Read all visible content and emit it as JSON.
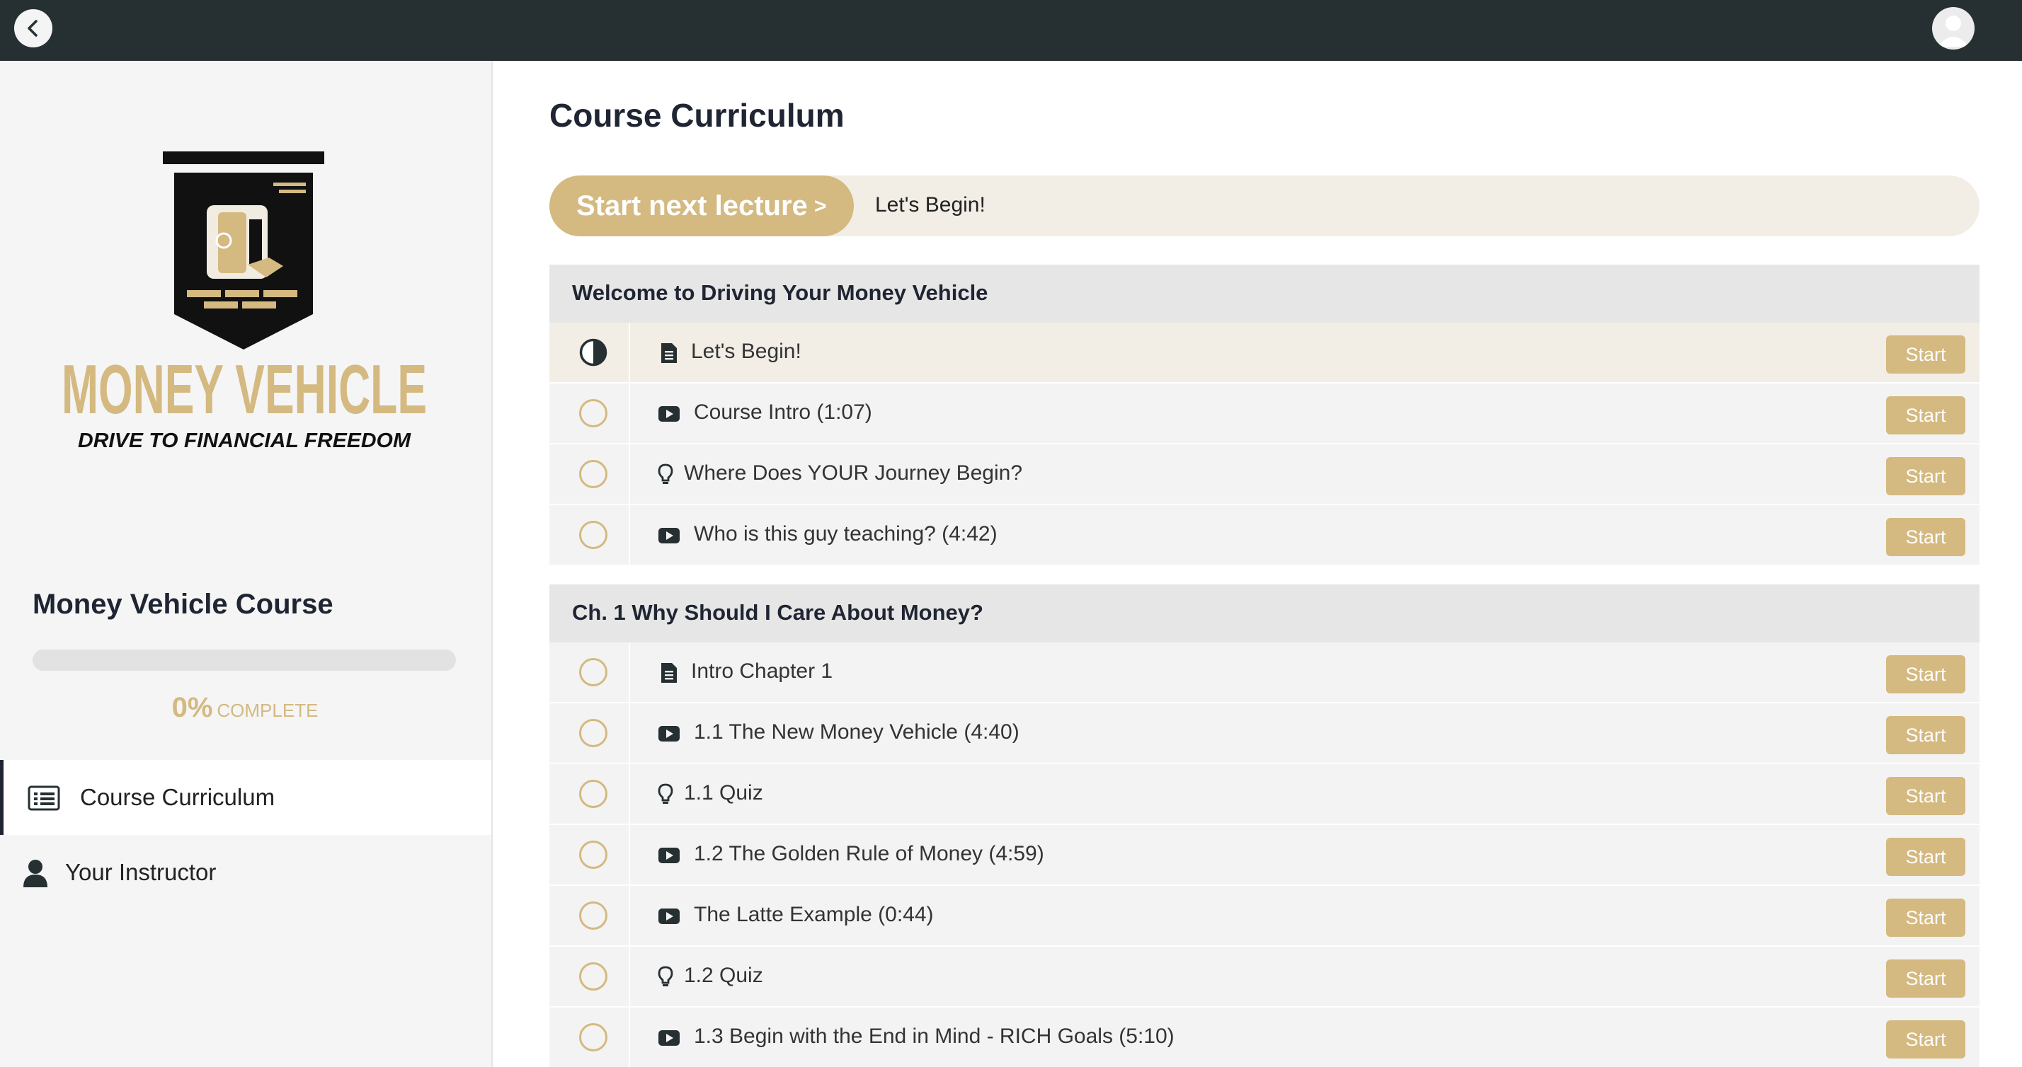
{
  "topbar": {
    "back_icon": "chevron-left-icon",
    "avatar_icon": "user-avatar-icon"
  },
  "sidebar": {
    "logo": {
      "brand": "MONEY VEHICLE",
      "tagline": "DRIVE TO FINANCIAL FREEDOM"
    },
    "course_title": "Money Vehicle Course",
    "progress": {
      "percent": 0,
      "percent_label": "0%",
      "complete_label": "COMPLETE"
    },
    "nav": [
      {
        "label": "Course Curriculum",
        "icon": "list-icon",
        "active": true
      },
      {
        "label": "Your Instructor",
        "icon": "user-icon",
        "active": false
      }
    ]
  },
  "main": {
    "title": "Course Curriculum",
    "next": {
      "button_label": "Start next lecture",
      "chevron": ">",
      "lecture": "Let's Begin!"
    },
    "sections": [
      {
        "title": "Welcome to Driving Your Money Vehicle",
        "lectures": [
          {
            "title": "Let's Begin!",
            "type": "document",
            "status": "in-progress",
            "action": "Start"
          },
          {
            "title": "Course Intro (1:07)",
            "type": "video",
            "status": "not-started",
            "action": "Start"
          },
          {
            "title": "Where Does YOUR Journey Begin?",
            "type": "quiz",
            "status": "not-started",
            "action": "Start"
          },
          {
            "title": "Who is this guy teaching? (4:42)",
            "type": "video",
            "status": "not-started",
            "action": "Start"
          }
        ]
      },
      {
        "title": "Ch. 1 Why Should I Care About Money?",
        "lectures": [
          {
            "title": "Intro Chapter 1",
            "type": "document",
            "status": "not-started",
            "action": "Start"
          },
          {
            "title": "1.1 The New Money Vehicle (4:40)",
            "type": "video",
            "status": "not-started",
            "action": "Start"
          },
          {
            "title": "1.1 Quiz",
            "type": "quiz",
            "status": "not-started",
            "action": "Start"
          },
          {
            "title": "1.2 The Golden Rule of Money (4:59)",
            "type": "video",
            "status": "not-started",
            "action": "Start"
          },
          {
            "title": "The Latte Example (0:44)",
            "type": "video",
            "status": "not-started",
            "action": "Start"
          },
          {
            "title": "1.2 Quiz",
            "type": "quiz",
            "status": "not-started",
            "action": "Start"
          },
          {
            "title": "1.3 Begin with the End in Mind - RICH Goals (5:10)",
            "type": "video",
            "status": "not-started",
            "action": "Start"
          }
        ]
      }
    ]
  },
  "colors": {
    "accent": "#d4b980",
    "dark": "#263033",
    "navy": "#1f2532",
    "row": "#f3f3f3",
    "row_current": "#f2eee6",
    "header": "#e6e6e6"
  }
}
